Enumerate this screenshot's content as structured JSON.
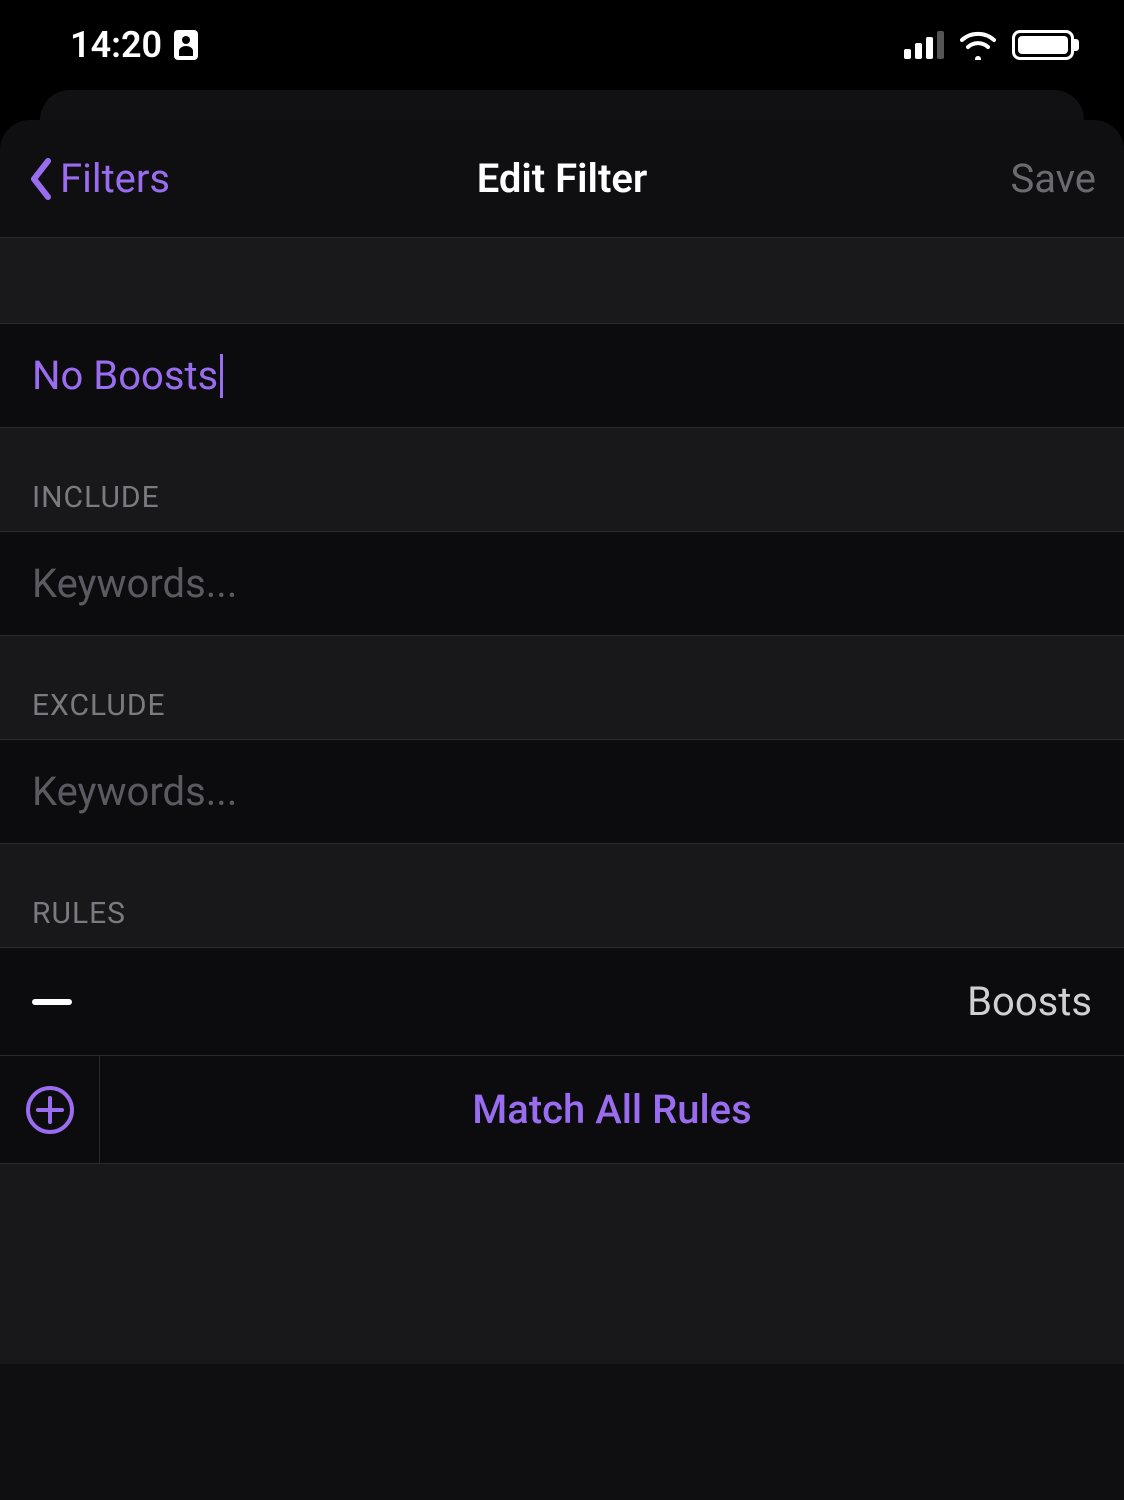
{
  "status": {
    "time": "14:20"
  },
  "nav": {
    "back_label": "Filters",
    "title": "Edit Filter",
    "save_label": "Save"
  },
  "filter_name": {
    "value": "No Boosts"
  },
  "sections": {
    "include": {
      "header": "INCLUDE",
      "placeholder": "Keywords..."
    },
    "exclude": {
      "header": "EXCLUDE",
      "placeholder": "Keywords..."
    },
    "rules": {
      "header": "RULES",
      "items": [
        {
          "operator": "minus",
          "label": "Boosts"
        }
      ],
      "match_all_label": "Match All Rules"
    }
  },
  "colors": {
    "accent": "#9a6cf0",
    "bg": "#000000",
    "sheet": "#0f0f11",
    "cell": "#0c0c0e",
    "section": "#18181b",
    "muted": "#6a6a70"
  }
}
